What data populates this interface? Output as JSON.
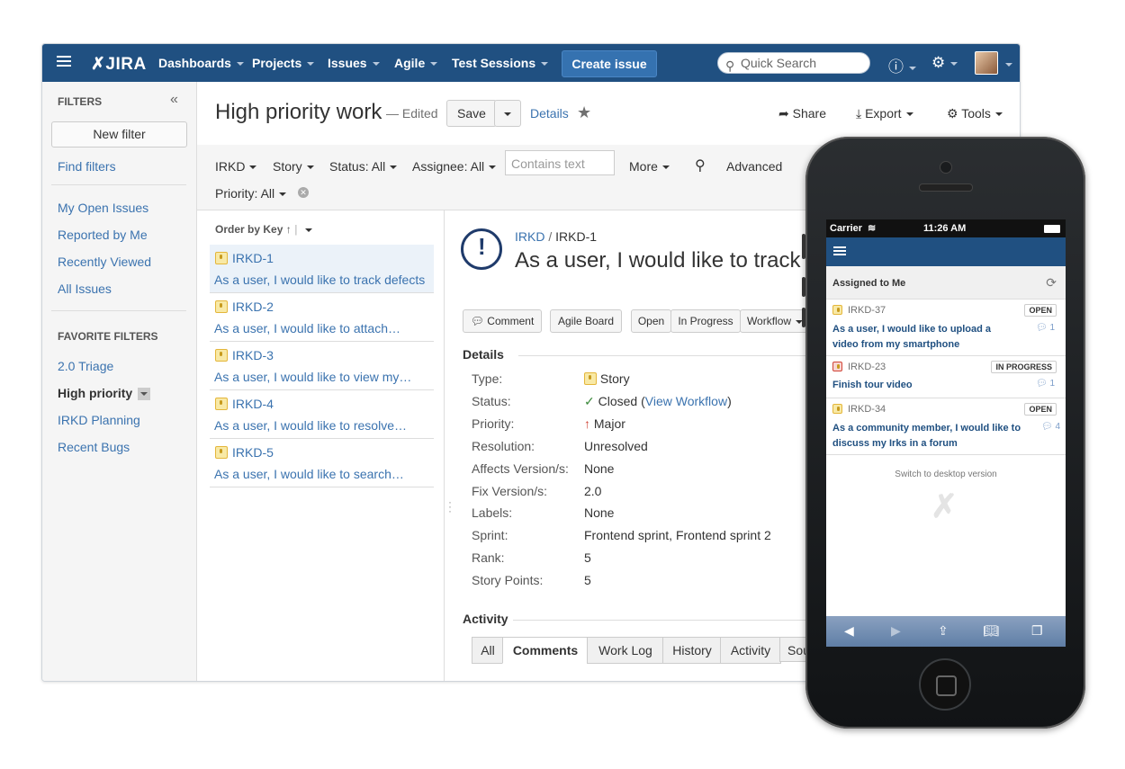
{
  "nav": {
    "logo": "JIRA",
    "items": [
      "Dashboards",
      "Projects",
      "Issues",
      "Agile",
      "Test Sessions"
    ],
    "create": "Create issue",
    "search_placeholder": "Quick Search"
  },
  "sidebar": {
    "heading": "FILTERS",
    "new_filter": "New filter",
    "find_filters": "Find filters",
    "links": [
      "My Open Issues",
      "Reported by Me",
      "Recently Viewed",
      "All Issues"
    ],
    "favorites_heading": "FAVORITE FILTERS",
    "favorites": [
      "2.0 Triage",
      "High priority",
      "IRKD Planning",
      "Recent Bugs"
    ]
  },
  "header": {
    "title": "High priority work",
    "edited": "— Edited",
    "save": "Save",
    "details": "Details",
    "share": "Share",
    "export": "Export",
    "tools": "Tools"
  },
  "filters": {
    "project": "IRKD",
    "type": "Story",
    "status": "Status: All",
    "assignee": "Assignee: All",
    "text_placeholder": "Contains text",
    "more": "More",
    "advanced": "Advanced",
    "priority": "Priority: All"
  },
  "list": {
    "order_by": "Order by Key",
    "issues": [
      {
        "key": "IRKD-1",
        "summary": "As a user, I would like to track defects"
      },
      {
        "key": "IRKD-2",
        "summary": "As a user, I would like to attach…"
      },
      {
        "key": "IRKD-3",
        "summary": "As a user, I would like to view my…"
      },
      {
        "key": "IRKD-4",
        "summary": "As a user, I would like to resolve…"
      },
      {
        "key": "IRKD-5",
        "summary": "As a user, I would like to search…"
      }
    ]
  },
  "issue": {
    "project": "IRKD",
    "key": "IRKD-1",
    "title": "As a user, I would like to track",
    "actions": [
      "Comment",
      "Agile Board",
      "Open",
      "In Progress",
      "Workflow"
    ],
    "details_heading": "Details",
    "fields": [
      {
        "label": "Type:",
        "value": "Story"
      },
      {
        "label": "Status:",
        "value": "Closed"
      },
      {
        "label": "Priority:",
        "value": "Major"
      },
      {
        "label": "Resolution:",
        "value": "Unresolved"
      },
      {
        "label": "Affects Version/s:",
        "value": "None"
      },
      {
        "label": "Fix Version/s:",
        "value": "2.0"
      },
      {
        "label": "Labels:",
        "value": "None"
      },
      {
        "label": "Sprint:",
        "value": "Frontend sprint, Frontend sprint 2"
      },
      {
        "label": "Rank:",
        "value": "5"
      },
      {
        "label": "Story Points:",
        "value": "5"
      }
    ],
    "view_workflow": "View Workflow",
    "activity_heading": "Activity",
    "tabs": [
      "All",
      "Comments",
      "Work Log",
      "History",
      "Activity",
      "Sou"
    ]
  },
  "mobile": {
    "carrier": "Carrier",
    "time": "11:26 AM",
    "section": "Assigned to Me",
    "items": [
      {
        "key": "IRKD-37",
        "summary": "As a user, I would like to upload a video from my smartphone",
        "status": "OPEN",
        "comments": "1"
      },
      {
        "key": "IRKD-23",
        "summary": "Finish tour video",
        "status": "IN PROGRESS",
        "comments": "1"
      },
      {
        "key": "IRKD-34",
        "summary": "As a community member, I would like to discuss my Irks in a forum",
        "status": "OPEN",
        "comments": "4"
      }
    ],
    "switch_desktop": "Switch to desktop version"
  },
  "colors": {
    "brand": "#205081",
    "link": "#3b73af",
    "create_button": "#3572b0"
  }
}
